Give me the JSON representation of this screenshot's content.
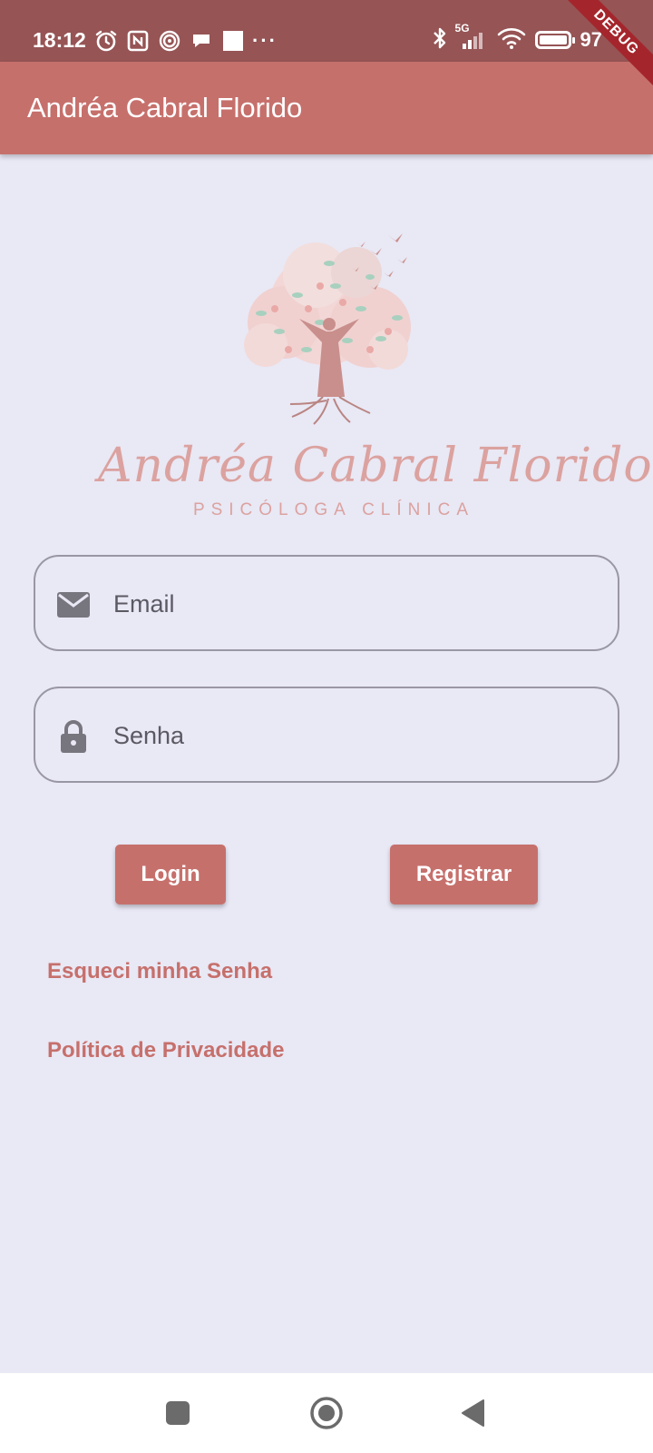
{
  "status_bar": {
    "time": "18:12",
    "overflow": "···",
    "network": "5G",
    "battery_text": "97",
    "icons": [
      "alarm-icon",
      "nfc-icon",
      "hotspot-icon",
      "chat-icon",
      "square-icon",
      "bluetooth-icon",
      "signal-icon",
      "wifi-icon",
      "battery-icon"
    ]
  },
  "debug_banner": "DEBUG",
  "app_bar": {
    "title": "Andréa Cabral Florido"
  },
  "logo": {
    "name": "Andréa Cabral Florido",
    "subtitle": "PSICÓLOGA CLÍNICA"
  },
  "form": {
    "email": {
      "placeholder": "Email",
      "value": "",
      "icon": "email-icon"
    },
    "password": {
      "placeholder": "Senha",
      "value": "",
      "icon": "lock-icon"
    }
  },
  "buttons": {
    "login": "Login",
    "register": "Registrar"
  },
  "links": {
    "forgot": "Esqueci minha Senha",
    "privacy": "Política de Privacidade"
  },
  "nav": [
    "recents-button",
    "home-button",
    "back-button"
  ],
  "colors": {
    "status_bar": "#965455",
    "primary": "#c6706c",
    "background": "#e9e8f5",
    "logo_pink": "#dba29f"
  }
}
